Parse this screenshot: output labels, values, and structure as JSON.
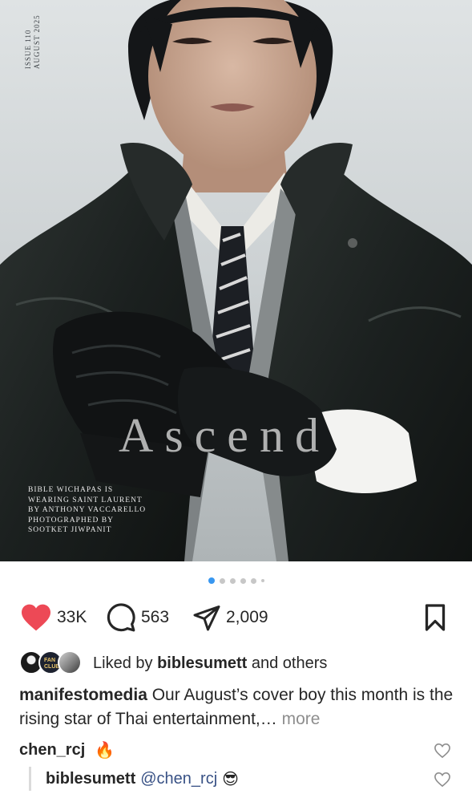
{
  "magazine": {
    "issue": "ISSUE 110",
    "date": "AUGUST 2025",
    "title": "Ascend",
    "credits": [
      "BIBLE WICHAPAS IS",
      "WEARING SAINT LAURENT",
      "BY ANTHONY VACCARELLO",
      "PHOTOGRAPHED BY",
      "SOOTKET JIWPANIT"
    ]
  },
  "carousel": {
    "total_dots": 6,
    "active_index": 0
  },
  "actions": {
    "likes": "33K",
    "comments": "563",
    "shares": "2,009",
    "like_icon": "heart-filled-icon",
    "comment_icon": "comment-bubble-icon",
    "share_icon": "paper-plane-icon",
    "save_icon": "bookmark-icon",
    "like_color": "#ed4956"
  },
  "liked_by": {
    "prefix": "Liked by ",
    "user": "biblesumett",
    "suffix": " and others",
    "avatar_badge": "FAN CLUB"
  },
  "caption": {
    "user": "manifestomedia",
    "text": " Our August’s cover boy this month is the rising star of Thai entertainment,…",
    "more": " more"
  },
  "comments": [
    {
      "user": "chen_rcj",
      "text": "",
      "emoji": "🔥"
    },
    {
      "user": "biblesumett",
      "mention": "@chen_rcj",
      "emoji": "😎"
    }
  ]
}
